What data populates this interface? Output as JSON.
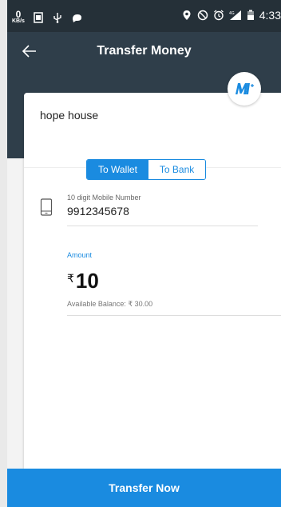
{
  "status_bar": {
    "net_speed_value": "0",
    "net_speed_unit": "KB/s",
    "network_label": "4G",
    "time": "4:33"
  },
  "header": {
    "title": "Transfer Money"
  },
  "payee": {
    "name": "hope house"
  },
  "tabs": {
    "wallet": "To Wallet",
    "bank": "To Bank",
    "active": "wallet"
  },
  "mobile": {
    "label": "10 digit Mobile Number",
    "value": "9912345678"
  },
  "amount": {
    "label": "Amount",
    "currency_symbol": "₹",
    "value": "10",
    "balance_text": "Available Balance: ₹ 30.00"
  },
  "actions": {
    "transfer_label": "Transfer Now"
  },
  "colors": {
    "accent": "#1a8be0",
    "header_bg": "#2f3e4a",
    "status_bg": "#253038"
  }
}
